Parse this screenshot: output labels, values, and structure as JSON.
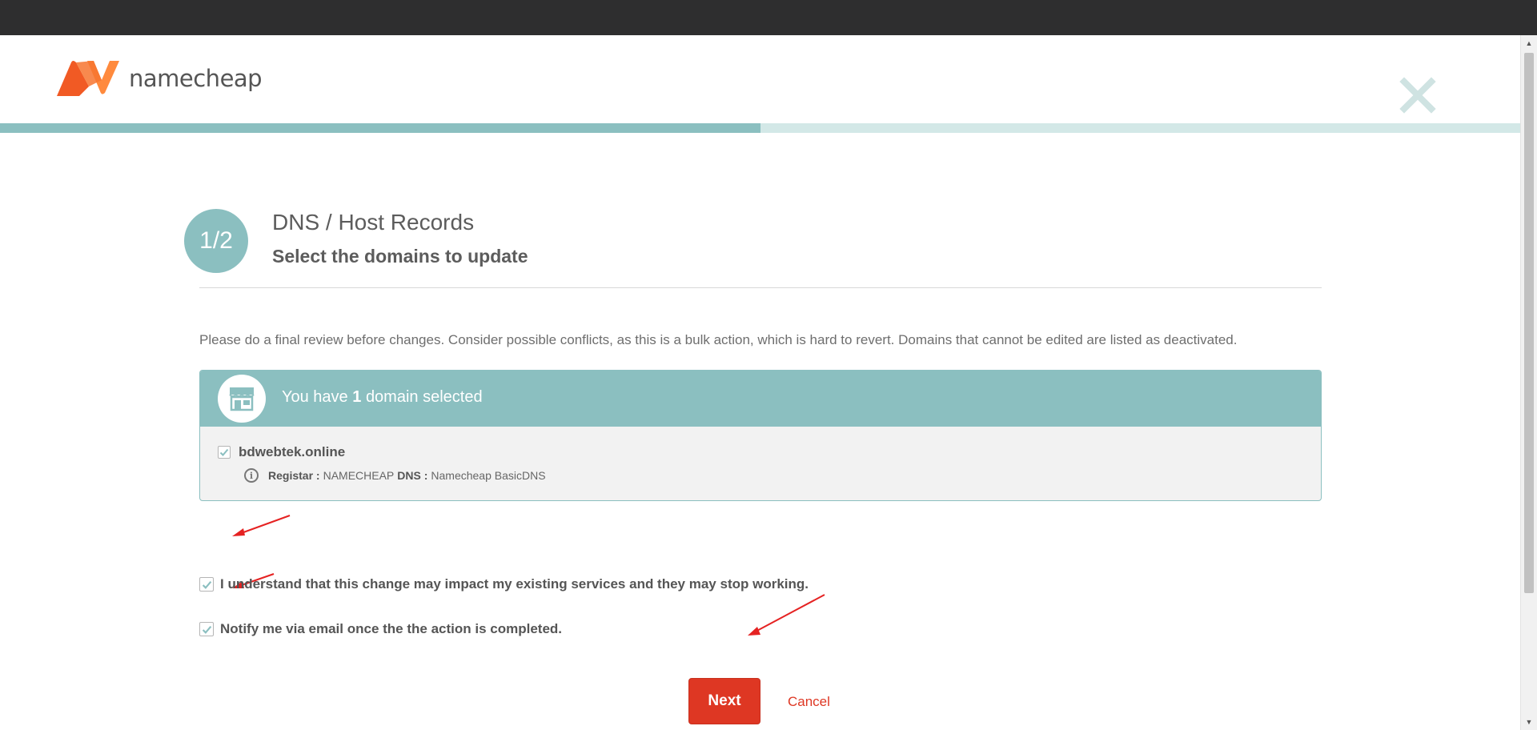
{
  "brand": {
    "name": "namecheap",
    "logo_color_a": "#f15a24",
    "logo_color_b": "#ff8a3d"
  },
  "header": {
    "close_icon": "close-icon"
  },
  "progress": {
    "fraction": 0.5
  },
  "step": {
    "indicator": "1/2",
    "title": "DNS / Host Records",
    "subtitle": "Select the domains to update"
  },
  "review": {
    "text": "Please do a final review before changes. Consider possible conflicts, as this is a bulk action, which is hard to revert. Domains that cannot be edited are listed as deactivated."
  },
  "selection": {
    "prefix": "You have",
    "count": "1",
    "suffix": "domain selected",
    "icon": "store-icon",
    "domains": [
      {
        "name": "bdwebtek.online",
        "checked": true,
        "registrar_label": "Registar :",
        "registrar_value": "NAMECHEAP",
        "dns_label": "DNS :",
        "dns_value": "Namecheap BasicDNS"
      }
    ]
  },
  "consents": {
    "impact": {
      "label": "I understand that this change may impact my existing services and they may stop working.",
      "checked": true
    },
    "notify": {
      "label": "Notify me via email once the the action is completed.",
      "checked": true
    }
  },
  "actions": {
    "next_label": "Next",
    "cancel_label": "Cancel"
  },
  "colors": {
    "teal": "#8bbfc0",
    "teal_light": "#d3e8e7",
    "accent_red": "#de3723"
  }
}
